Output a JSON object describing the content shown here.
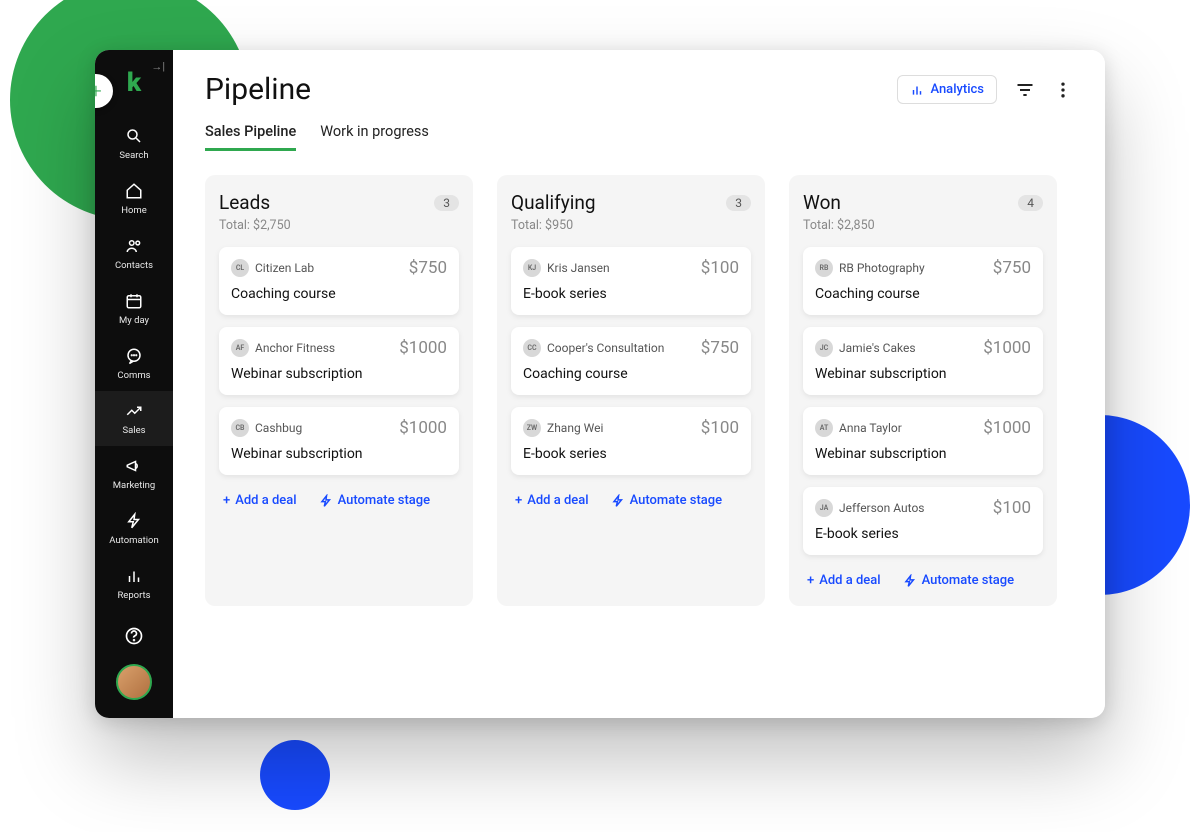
{
  "page": {
    "title": "Pipeline"
  },
  "sidebar": {
    "items": [
      {
        "label": "Search"
      },
      {
        "label": "Home"
      },
      {
        "label": "Contacts"
      },
      {
        "label": "My day"
      },
      {
        "label": "Comms"
      },
      {
        "label": "Sales"
      },
      {
        "label": "Marketing"
      },
      {
        "label": "Automation"
      },
      {
        "label": "Reports"
      }
    ]
  },
  "header": {
    "analytics": "Analytics"
  },
  "tabs": [
    {
      "label": "Sales Pipeline",
      "active": true
    },
    {
      "label": "Work in progress",
      "active": false
    }
  ],
  "actions": {
    "add_deal": "Add a deal",
    "automate_stage": "Automate stage"
  },
  "columns": [
    {
      "title": "Leads",
      "count": "3",
      "total": "Total: $2,750",
      "deals": [
        {
          "initials": "CL",
          "company": "Citizen Lab",
          "price": "$750",
          "title": "Coaching course"
        },
        {
          "initials": "AF",
          "company": "Anchor Fitness",
          "price": "$1000",
          "title": "Webinar subscription"
        },
        {
          "initials": "CB",
          "company": "Cashbug",
          "price": "$1000",
          "title": "Webinar subscription"
        }
      ]
    },
    {
      "title": "Qualifying",
      "count": "3",
      "total": "Total: $950",
      "deals": [
        {
          "initials": "KJ",
          "company": "Kris Jansen",
          "price": "$100",
          "title": "E-book series"
        },
        {
          "initials": "CC",
          "company": "Cooper's Consultation",
          "price": "$750",
          "title": "Coaching course"
        },
        {
          "initials": "ZW",
          "company": "Zhang Wei",
          "price": "$100",
          "title": "E-book series"
        }
      ]
    },
    {
      "title": "Won",
      "count": "4",
      "total": "Total: $2,850",
      "deals": [
        {
          "initials": "RB",
          "company": "RB Photography",
          "price": "$750",
          "title": "Coaching course"
        },
        {
          "initials": "JC",
          "company": "Jamie's Cakes",
          "price": "$1000",
          "title": "Webinar subscription"
        },
        {
          "initials": "AT",
          "company": "Anna Taylor",
          "price": "$1000",
          "title": "Webinar subscription"
        },
        {
          "initials": "JA",
          "company": "Jefferson Autos",
          "price": "$100",
          "title": "E-book series"
        }
      ]
    }
  ]
}
